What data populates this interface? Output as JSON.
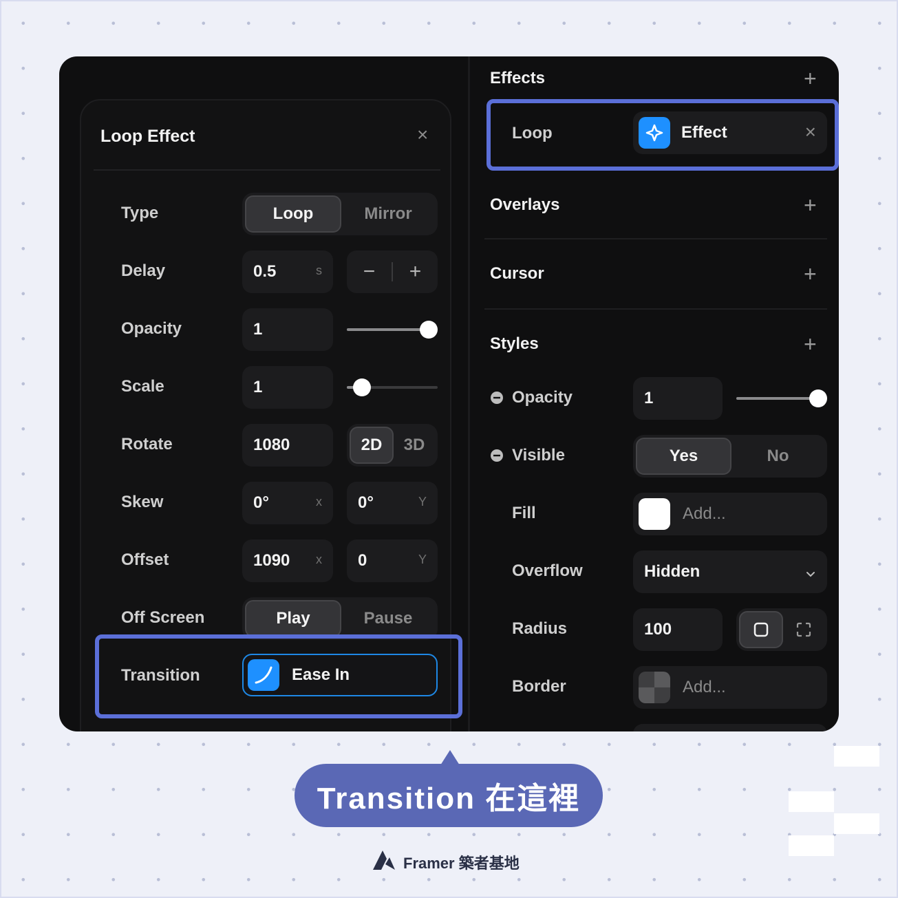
{
  "loop_effect": {
    "title": "Loop Effect",
    "close_icon": "×",
    "type_label": "Type",
    "type_options": [
      "Loop",
      "Mirror"
    ],
    "delay_label": "Delay",
    "delay_value": "0.5",
    "delay_unit": "s",
    "minus": "−",
    "plus": "+",
    "opacity_label": "Opacity",
    "opacity_value": "1",
    "opacity_level": 1.0,
    "scale_label": "Scale",
    "scale_value": "1",
    "scale_level": 0.17,
    "rotate_label": "Rotate",
    "rotate_value": "1080",
    "rotate_modes": [
      "2D",
      "3D"
    ],
    "skew_label": "Skew",
    "skew_x": "0°",
    "skew_y": "0°",
    "x_axis": "x",
    "y_axis": "Y",
    "offset_label": "Offset",
    "offset_x": "1090",
    "offset_y": "0",
    "offscreen_label": "Off Screen",
    "offscreen_options": [
      "Play",
      "Pause"
    ],
    "transition_label": "Transition",
    "transition_value": "Ease In"
  },
  "effects_panel": {
    "effects_title": "Effects",
    "loop_label": "Loop",
    "effect_chip": "Effect",
    "chip_close": "×",
    "overlays_title": "Overlays",
    "cursor_title": "Cursor",
    "styles_title": "Styles",
    "opacity_label": "Opacity",
    "opacity_value": "1",
    "opacity_level": 1.0,
    "visible_label": "Visible",
    "visible_options": [
      "Yes",
      "No"
    ],
    "fill_label": "Fill",
    "fill_placeholder": "Add...",
    "overflow_label": "Overflow",
    "overflow_value": "Hidden",
    "radius_label": "Radius",
    "radius_value": "100",
    "border_label": "Border",
    "border_placeholder": "Add...",
    "plus": "+"
  },
  "caption": {
    "bubble_text": "Transition 在這裡",
    "brand_text": "Framer 築者基地"
  },
  "colors": {
    "accent": "#5b6fd8",
    "blue": "#1e90ff",
    "panel_bg": "#0f0f10",
    "bubble": "#5a68b5"
  }
}
